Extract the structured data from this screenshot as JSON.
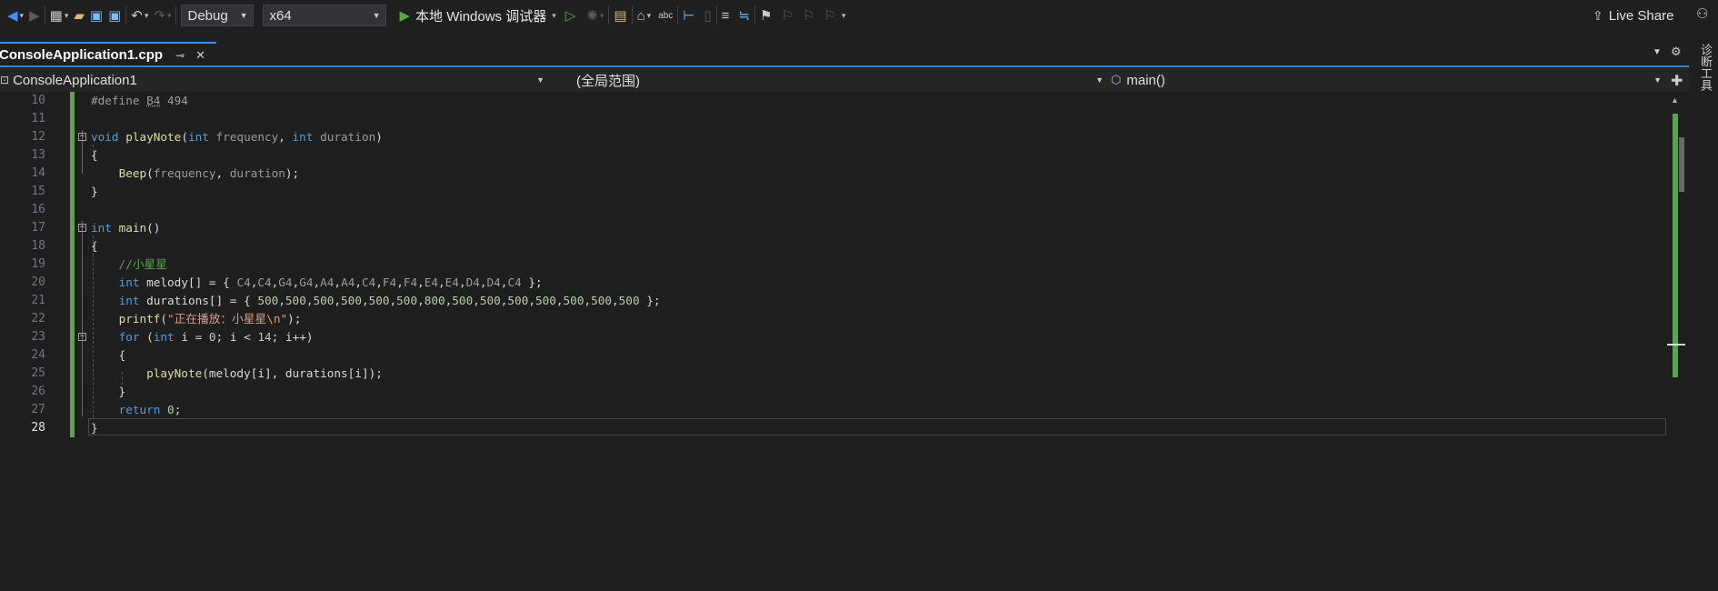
{
  "toolbar": {
    "config": "Debug",
    "platform": "x64",
    "run_label": "本地 Windows 调试器",
    "live_share": "Live Share",
    "icons": [
      "back-icon",
      "forward-icon",
      "new-project-icon",
      "open-icon",
      "save-icon",
      "save-all-icon",
      "undo-icon",
      "redo-icon",
      "play-icon",
      "play-outline-icon",
      "hot-reload-icon",
      "browse-folder-icon",
      "layout-icon",
      "spelling-icon",
      "breakpoint-icon",
      "comment-icon",
      "uncomment-icon",
      "bookmark-icon",
      "person-icon"
    ]
  },
  "tab": {
    "title": "ConsoleApplication1.cpp",
    "pin": "⊸",
    "close": "✕"
  },
  "nav": {
    "project": "ConsoleApplication1",
    "scope": "(全局范围)",
    "member": "main()"
  },
  "side": {
    "label": "诊断工具"
  },
  "editor": {
    "current_line": 28,
    "lines": [
      {
        "n": "10",
        "text": "#define B4 494"
      },
      {
        "n": "11",
        "text": ""
      },
      {
        "n": "12",
        "text": "void playNote(int frequency, int duration)"
      },
      {
        "n": "13",
        "text": "{"
      },
      {
        "n": "14",
        "text": "    Beep(frequency, duration);"
      },
      {
        "n": "15",
        "text": "}"
      },
      {
        "n": "16",
        "text": ""
      },
      {
        "n": "17",
        "text": "int main()"
      },
      {
        "n": "18",
        "text": "{"
      },
      {
        "n": "19",
        "text": "    //小星星"
      },
      {
        "n": "20",
        "text": "    int melody[] = { C4,C4,G4,G4,A4,A4,C4,F4,F4,E4,E4,D4,D4,C4 };"
      },
      {
        "n": "21",
        "text": "    int durations[] = { 500,500,500,500,500,500,800,500,500,500,500,500,500,500 };"
      },
      {
        "n": "22",
        "text": "    printf(\"正在播放：小星星\\n\");"
      },
      {
        "n": "23",
        "text": "    for (int i = 0; i < 14; i++)"
      },
      {
        "n": "24",
        "text": "    {"
      },
      {
        "n": "25",
        "text": "        playNote(melody[i], durations[i]);"
      },
      {
        "n": "26",
        "text": "    }"
      },
      {
        "n": "27",
        "text": "    return 0;"
      },
      {
        "n": "28",
        "text": "}"
      }
    ]
  },
  "colors": {
    "keyword": "#569cd6",
    "function": "#dcdcaa",
    "comment": "#57a64a",
    "string": "#d69d85",
    "accent": "#3794ff",
    "changed": "#57a64a"
  }
}
